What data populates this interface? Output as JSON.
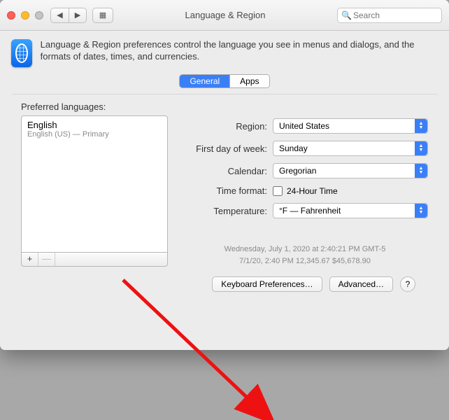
{
  "window": {
    "title": "Language & Region",
    "search_placeholder": "Search"
  },
  "header": {
    "description": "Language & Region preferences control the language you see in menus and dialogs, and the formats of dates, times, and currencies."
  },
  "tabs": {
    "general": "General",
    "apps": "Apps",
    "active": "general"
  },
  "preferred": {
    "label": "Preferred languages:",
    "items": [
      {
        "name": "English",
        "sub": "English (US) — Primary"
      }
    ],
    "add": "+",
    "remove": "—"
  },
  "settings": {
    "region_label": "Region:",
    "region_value": "United States",
    "firstday_label": "First day of week:",
    "firstday_value": "Sunday",
    "calendar_label": "Calendar:",
    "calendar_value": "Gregorian",
    "timeformat_label": "Time format:",
    "timeformat_check_label": "24-Hour Time",
    "timeformat_checked": false,
    "temperature_label": "Temperature:",
    "temperature_value": "°F — Fahrenheit"
  },
  "examples": {
    "line1": "Wednesday, July 1, 2020 at 2:40:21 PM GMT-5",
    "line2": "7/1/20, 2:40 PM    12,345.67    $45,678.90"
  },
  "footer": {
    "keyboard": "Keyboard Preferences…",
    "advanced": "Advanced…",
    "help": "?"
  }
}
